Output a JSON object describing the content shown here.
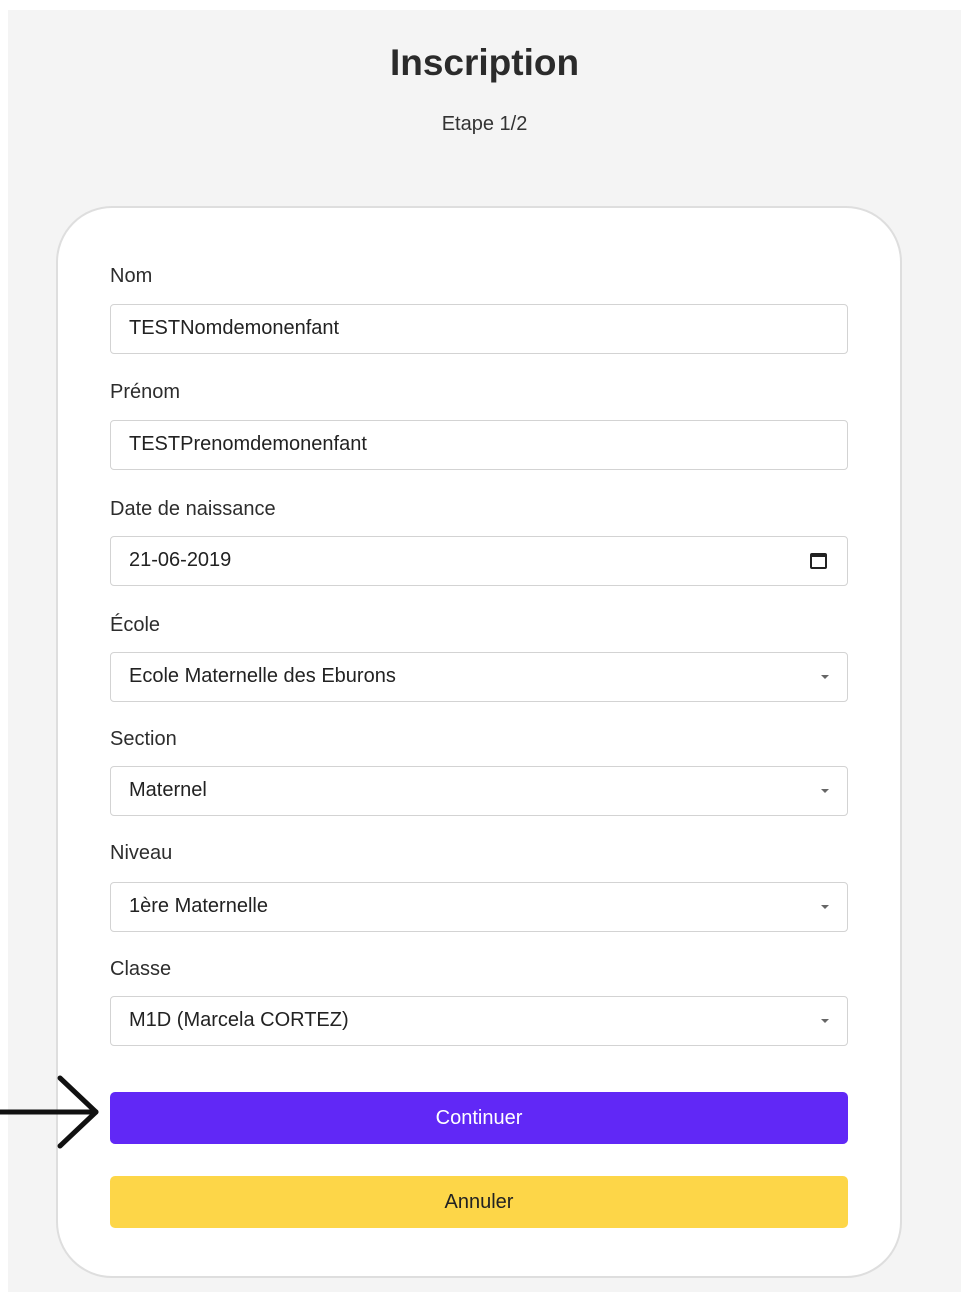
{
  "header": {
    "title": "Inscription",
    "step": "Etape 1/2"
  },
  "form": {
    "fields": [
      {
        "label": "Nom",
        "value": "TESTNomdemonenfant",
        "type": "text"
      },
      {
        "label": "Prénom",
        "value": "TESTPrenomdemonenfant",
        "type": "text"
      },
      {
        "label": "Date de naissance",
        "value": "21-06-2019",
        "type": "date"
      },
      {
        "label": "École",
        "value": "Ecole Maternelle des Eburons",
        "type": "select"
      },
      {
        "label": "Section",
        "value": "Maternel",
        "type": "select"
      },
      {
        "label": "Niveau",
        "value": "1ère Maternelle",
        "type": "select"
      },
      {
        "label": "Classe",
        "value": "M1D (Marcela CORTEZ)",
        "type": "select"
      }
    ],
    "continue_label": "Continuer",
    "cancel_label": "Annuler"
  },
  "colors": {
    "primary": "#6128f6",
    "secondary": "#fdd648",
    "background": "#f4f4f4"
  },
  "icons": {
    "date": "calendar-icon",
    "select": "caret-down-icon",
    "pointer": "arrow-right-icon"
  }
}
